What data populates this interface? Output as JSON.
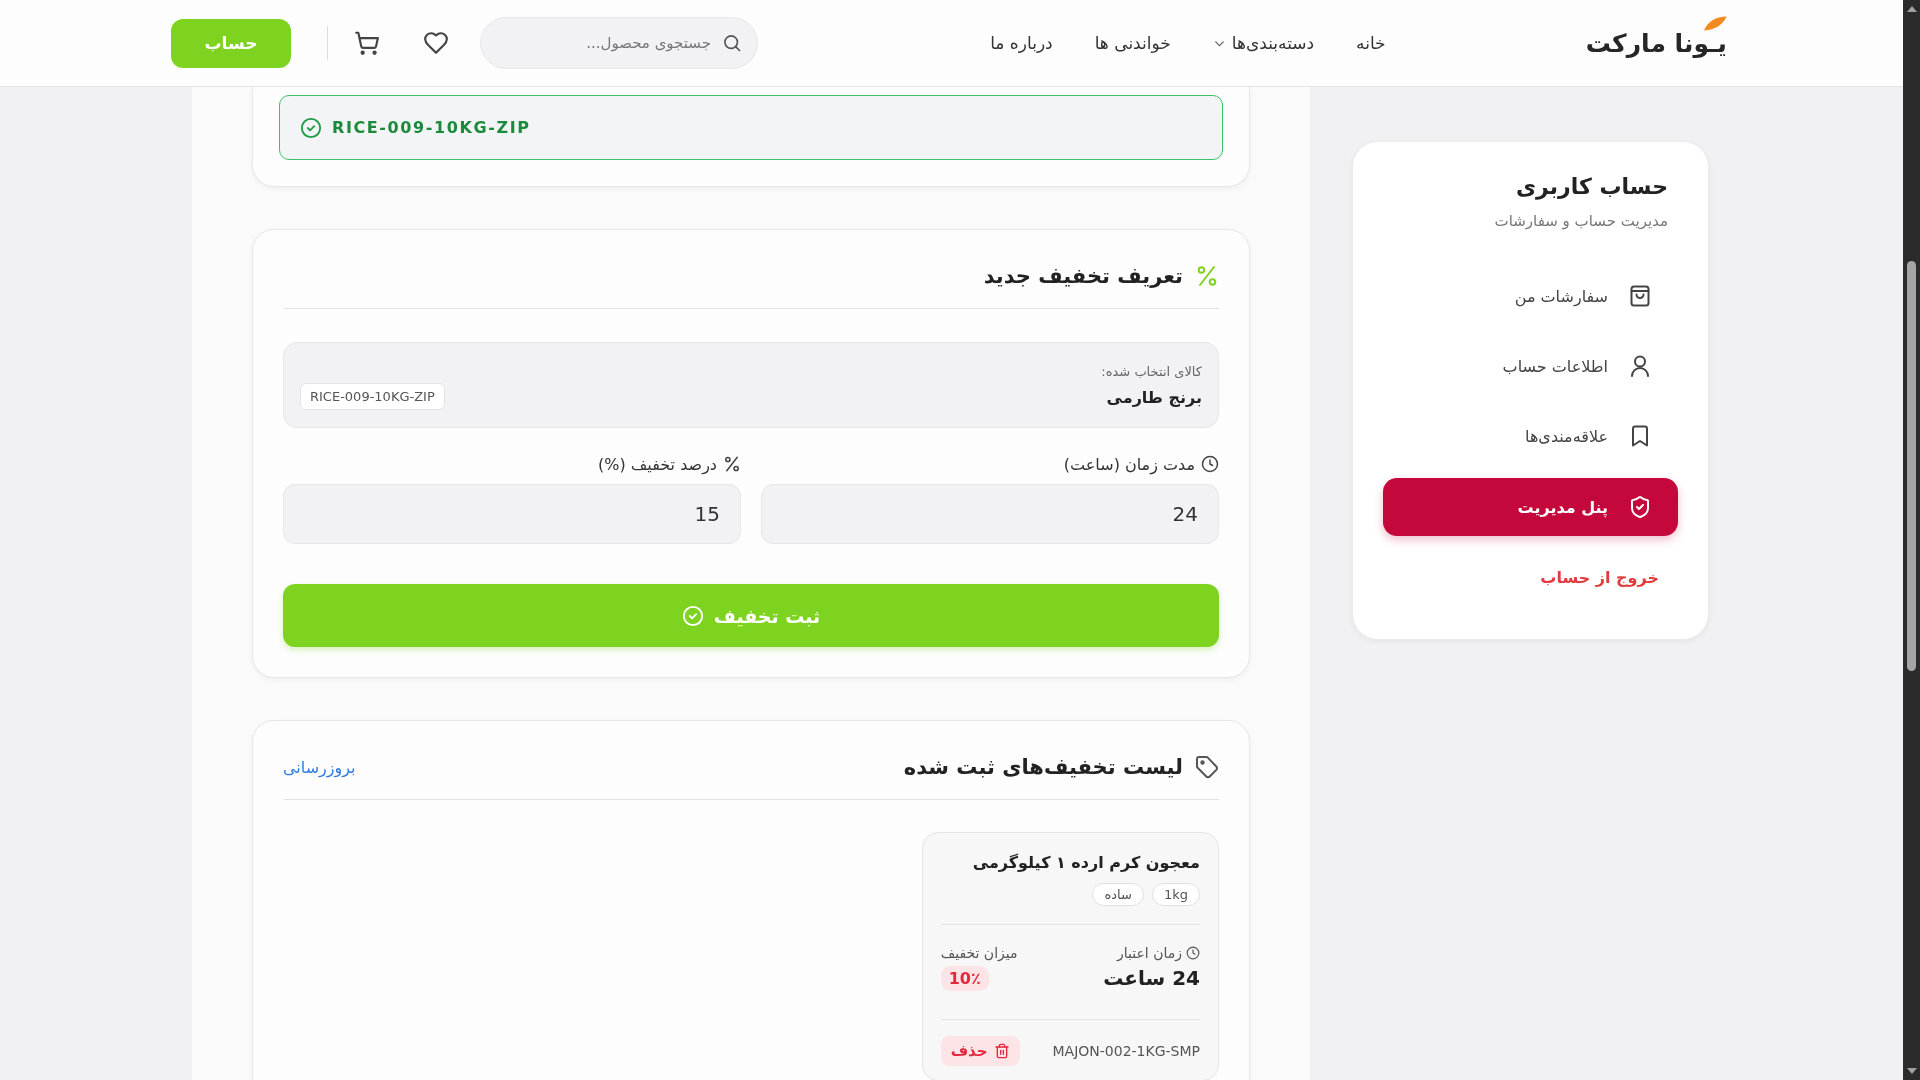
{
  "header": {
    "logo": "یـونا مارکت",
    "nav": [
      {
        "label": "خانه",
        "dropdown": false
      },
      {
        "label": "دسته‌بندی‌ها",
        "dropdown": true
      },
      {
        "label": "خواندنی ها",
        "dropdown": false
      },
      {
        "label": "درباره ما",
        "dropdown": false
      }
    ],
    "search": {
      "placeholder": "جستجوی محصول..."
    },
    "account_button": "حساب"
  },
  "sku_banner": {
    "code": "RICE-009-10KG-ZIP"
  },
  "discount_form": {
    "title": "تعریف تخفیف جدید",
    "selected_product": {
      "label": "کالای انتخاب شده:",
      "name": "برنج طارمی",
      "sku": "RICE-009-10KG-ZIP"
    },
    "fields": [
      {
        "kind": "duration",
        "label": "مدت زمان (ساعت)",
        "value": "24"
      },
      {
        "kind": "percent",
        "label": "درصد تخفیف (%)",
        "value": "15"
      }
    ],
    "submit": "ثبت تخفیف"
  },
  "discount_list": {
    "title": "لیست تخفیف‌های ثبت شده",
    "refresh": "بروزرسانی",
    "items": [
      {
        "name": "معجون کرم ارده ۱ کیلوگرمی",
        "tags": [
          "1kg",
          "ساده"
        ],
        "validity_label": "زمان اعتبار",
        "validity": "24 ساعت",
        "amount_label": "میزان تخفیف",
        "amount": "10٪",
        "sku": "MAJON-002-1KG-SMP",
        "delete": "حذف"
      }
    ]
  },
  "sidebar": {
    "title": "حساب کاربری",
    "subtitle": "مدیریت حساب و سفارشات",
    "items": [
      {
        "kind": "orders",
        "label": "سفارشات من",
        "selected": false
      },
      {
        "kind": "profile",
        "label": "اطلاعات حساب",
        "selected": false
      },
      {
        "kind": "wishlist",
        "label": "علاقه‌مندی‌ها",
        "selected": false
      },
      {
        "kind": "admin",
        "label": "پنل مدیریت",
        "selected": true
      }
    ],
    "logout": "خروج از حساب"
  }
}
